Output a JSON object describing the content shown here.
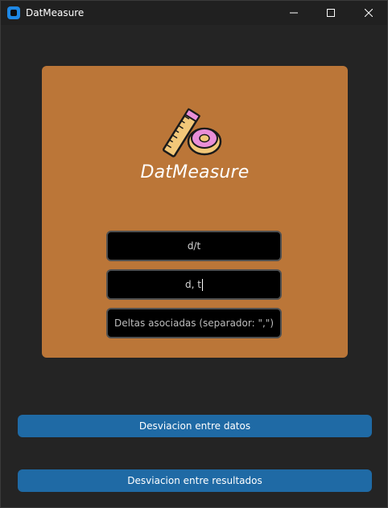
{
  "window": {
    "title": "DatMeasure"
  },
  "card": {
    "brand": "DatMeasure",
    "logo_icon": "measuring-tape-icon"
  },
  "fields": {
    "field1_value": "d/t",
    "field2_value": "d, t",
    "field3_placeholder": "Deltas asociadas (separador: \",\")"
  },
  "buttons": {
    "datos_label": "Desviacion entre datos",
    "resultados_label": "Desviacion entre resultados"
  },
  "colors": {
    "background": "#242424",
    "card": "#bb7638",
    "button": "#1f6aa5",
    "input": "#000000"
  }
}
